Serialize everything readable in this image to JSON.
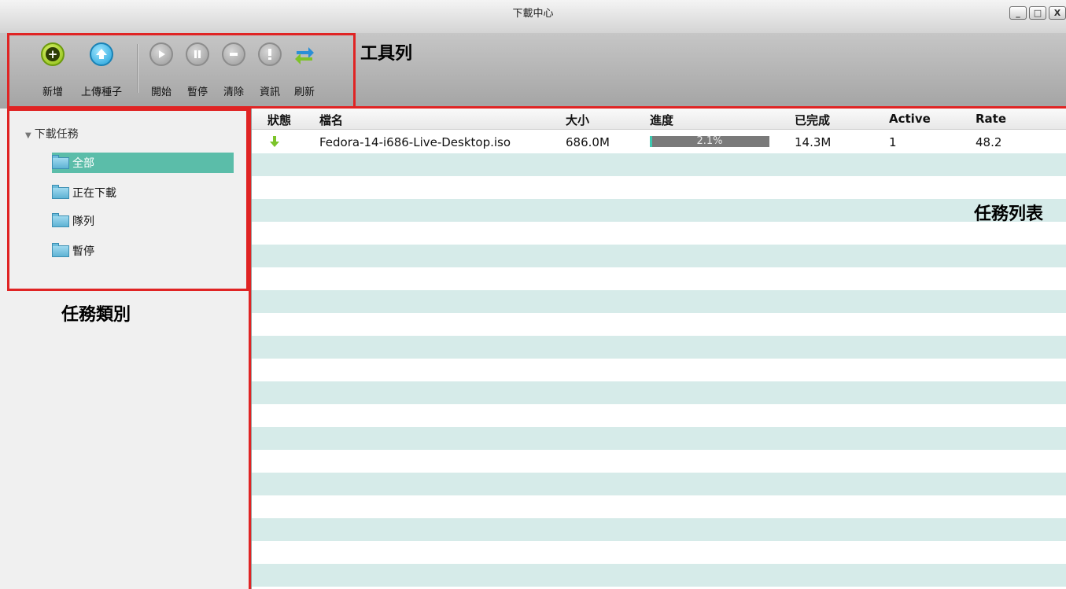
{
  "window": {
    "title": "下載中心",
    "controls": {
      "minimize": "_",
      "maximize": "□",
      "close": "X"
    }
  },
  "toolbar": {
    "buttons": [
      {
        "label": "新增",
        "icon": "add-icon"
      },
      {
        "label": "上傳種子",
        "icon": "upload-icon"
      },
      {
        "label": "開始",
        "icon": "play-icon"
      },
      {
        "label": "暫停",
        "icon": "pause-icon"
      },
      {
        "label": "清除",
        "icon": "remove-icon"
      },
      {
        "label": "資訊",
        "icon": "info-icon"
      },
      {
        "label": "刷新",
        "icon": "refresh-icon"
      }
    ]
  },
  "annotations": {
    "toolbar": "工具列",
    "categories": "任務類別",
    "tasklist": "任務列表"
  },
  "sidebar": {
    "root": "下載任務",
    "items": [
      {
        "label": "全部",
        "selected": true
      },
      {
        "label": "正在下載",
        "selected": false
      },
      {
        "label": "隊列",
        "selected": false
      },
      {
        "label": "暫停",
        "selected": false
      }
    ]
  },
  "table": {
    "columns": [
      "狀態",
      "檔名",
      "大小",
      "進度",
      "已完成",
      "Active",
      "Rate"
    ],
    "rows": [
      {
        "status": "downloading",
        "name": "Fedora-14-i686-Live-Desktop.iso",
        "size": "686.0M",
        "progress_text": "2.1%",
        "progress": 0.021,
        "completed": "14.3M",
        "active": "1",
        "rate": "48.2"
      }
    ]
  },
  "colors": {
    "selected": "#5bbda9",
    "stripe": "#d6ebe9",
    "annotation_box": "#e02424",
    "progress_fill": "#3dc9b0"
  }
}
